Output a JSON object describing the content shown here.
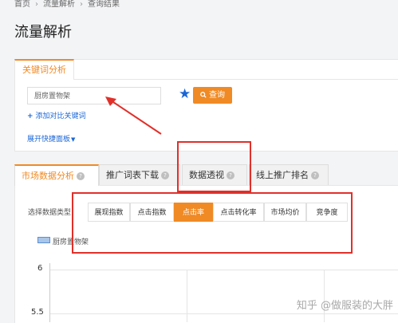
{
  "breadcrumb": [
    "首页",
    "流量解析",
    "查询结果"
  ],
  "page_title": "流量解析",
  "keyword_panel": {
    "tab_label": "关键词分析",
    "input_value": "厨房置物架",
    "query_button": "查询",
    "add_compare_label": "添加对比关键词",
    "expand_panel_label": "展开快捷面板"
  },
  "data_tabs": [
    "市场数据分析",
    "推广词表下载",
    "数据透视",
    "线上推广排名"
  ],
  "data_type": {
    "label": "选择数据类型：",
    "options": [
      "展现指数",
      "点击指数",
      "点击率",
      "点击转化率",
      "市场均价",
      "竞争度"
    ],
    "selected": "点击率"
  },
  "legend": {
    "series": "厨房置物架"
  },
  "chart_data": {
    "type": "line",
    "series": [
      {
        "name": "厨房置物架",
        "values": []
      }
    ],
    "y_ticks": [
      "6",
      "5.5"
    ]
  },
  "watermark": "知乎 @做服装的大胖",
  "colors": {
    "accent": "#f08a24",
    "link": "#1a66d6",
    "annotation": "#e0302a"
  },
  "icons": {
    "star": "star-icon",
    "search": "search-icon",
    "help": "question-icon",
    "plus": "plus-icon",
    "caret": "caret-down-icon"
  }
}
